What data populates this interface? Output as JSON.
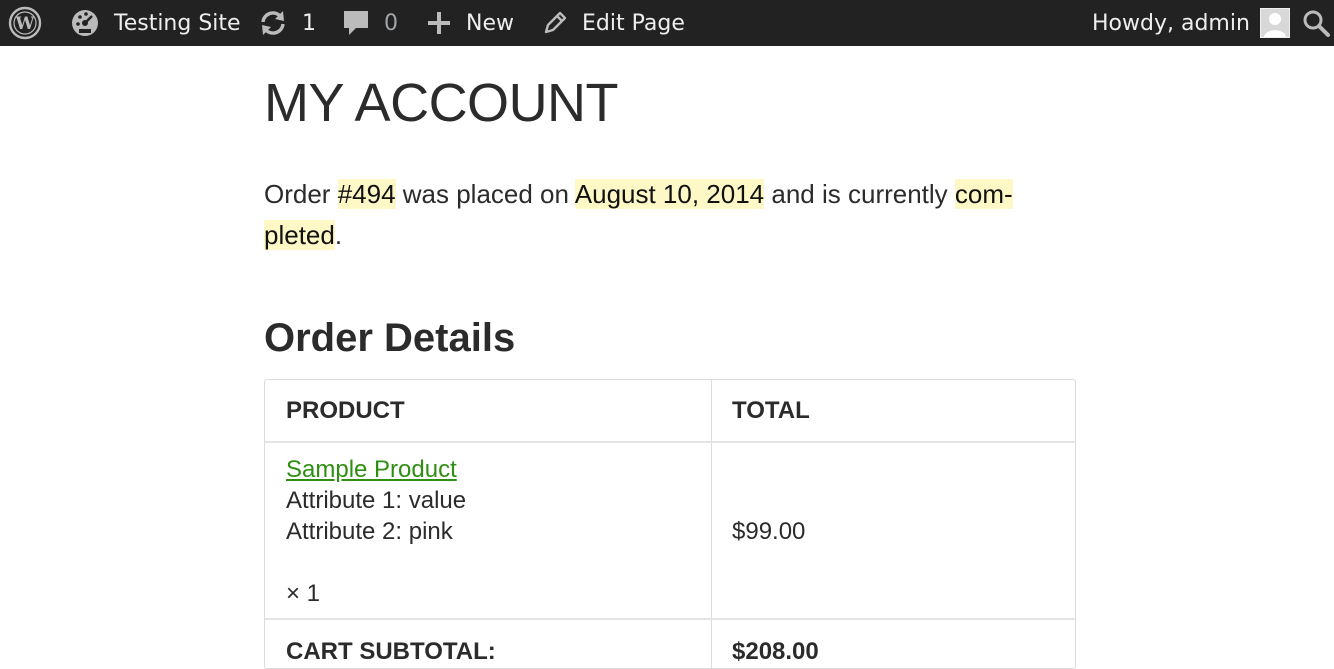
{
  "adminbar": {
    "site_name": "Testing Site",
    "updates_count": "1",
    "comments_count": "0",
    "new_label": "New",
    "edit_label": "Edit Page",
    "greeting": "Howdy, admin"
  },
  "page": {
    "title": "MY ACCOUNT"
  },
  "notice": {
    "prefix": "Order ",
    "order_number": "#494",
    "mid1": " was placed on ",
    "date": "August 10, 2014",
    "mid2": " and is currently ",
    "status_part1": "com-",
    "status_part2": "pleted",
    "suffix": "."
  },
  "order_details": {
    "title": "Order Details",
    "headers": [
      "PRODUCT",
      "TOTAL"
    ],
    "item": {
      "name": "Sample Product",
      "attributes": [
        "Attribute 1: value",
        "Attribute 2: pink"
      ],
      "quantity": "× 1",
      "total": "$99.00"
    },
    "subtotal_label": "CART SUBTOTAL:",
    "subtotal_value": "$208.00"
  },
  "colors": {
    "adminbar_bg": "#222222",
    "link_green": "#2f8f12",
    "highlight": "#fdf8c6"
  },
  "icons": [
    "wordpress-logo-icon",
    "dashboard-icon",
    "updates-icon",
    "comments-icon",
    "plus-icon",
    "pencil-icon",
    "avatar",
    "search-icon"
  ]
}
